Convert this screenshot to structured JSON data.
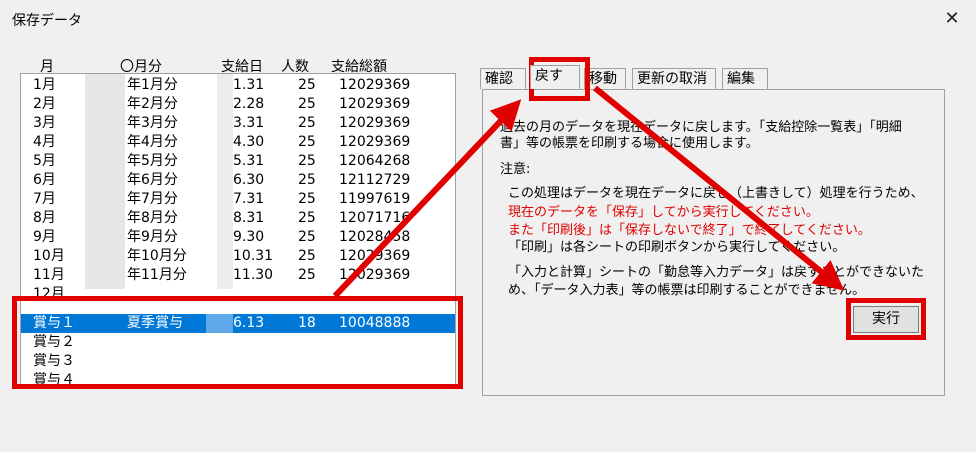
{
  "window": {
    "title": "保存データ",
    "close_glyph": "✕"
  },
  "columns": {
    "month": "月",
    "period": "〇月分",
    "paydate": "支給日",
    "count": "人数",
    "total": "支給総額"
  },
  "rows": [
    {
      "month": "1月",
      "period": "年1月分",
      "paydate": "1.31",
      "count": "25",
      "total": "12029369"
    },
    {
      "month": "2月",
      "period": "年2月分",
      "paydate": "2.28",
      "count": "25",
      "total": "12029369"
    },
    {
      "month": "3月",
      "period": "年3月分",
      "paydate": "3.31",
      "count": "25",
      "total": "12029369"
    },
    {
      "month": "4月",
      "period": "年4月分",
      "paydate": "4.30",
      "count": "25",
      "total": "12029369"
    },
    {
      "month": "5月",
      "period": "年5月分",
      "paydate": "5.31",
      "count": "25",
      "total": "12064268"
    },
    {
      "month": "6月",
      "period": "年6月分",
      "paydate": "6.30",
      "count": "25",
      "total": "12112729"
    },
    {
      "month": "7月",
      "period": "年7月分",
      "paydate": "7.31",
      "count": "25",
      "total": "11997619"
    },
    {
      "month": "8月",
      "period": "年8月分",
      "paydate": "8.31",
      "count": "25",
      "total": "12071716"
    },
    {
      "month": "9月",
      "period": "年9月分",
      "paydate": "9.30",
      "count": "25",
      "total": "12028458"
    },
    {
      "month": "10月",
      "period": "年10月分",
      "paydate": "10.31",
      "count": "25",
      "total": "12029369"
    },
    {
      "month": "11月",
      "period": "年11月分",
      "paydate": "11.30",
      "count": "25",
      "total": "12029369"
    },
    {
      "month": "12月",
      "period": "",
      "paydate": "",
      "count": "",
      "total": ""
    },
    {
      "month": "賞与１",
      "period": "夏季賞与",
      "paydate": "6.13",
      "count": "18",
      "total": "10048888"
    },
    {
      "month": "賞与２",
      "period": "",
      "paydate": "",
      "count": "",
      "total": ""
    },
    {
      "month": "賞与３",
      "period": "",
      "paydate": "",
      "count": "",
      "total": ""
    },
    {
      "month": "賞与４",
      "period": "",
      "paydate": "",
      "count": "",
      "total": ""
    }
  ],
  "tabs": [
    {
      "label": "確認"
    },
    {
      "label": "戻す"
    },
    {
      "label": "移動"
    },
    {
      "label": "更新の取消"
    },
    {
      "label": "編集"
    }
  ],
  "panel": {
    "line1": "過去の月のデータを現在データに戻します。「支給控除一覧表」「明細",
    "line2": "書」等の帳票を印刷する場合に使用します。",
    "note_label": "注意:",
    "note1": "この処理はデータを現在データに戻し（上書きして）処理を行うため、",
    "warn1": "現在のデータを「保存」してから実行してください。",
    "warn2": "また「印刷後」は「保存しないで終了」で終了してください。",
    "note2": "「印刷」は各シートの印刷ボタンから実行してください。",
    "note3": "「入力と計算」シートの「勤怠等入力データ」は戻すことができないた",
    "note4": "め、「データ入力表」等の帳票は印刷することができません。"
  },
  "exec_label": "実行",
  "colors": {
    "accent_red": "#e00000",
    "selection_blue": "#0078d7"
  }
}
